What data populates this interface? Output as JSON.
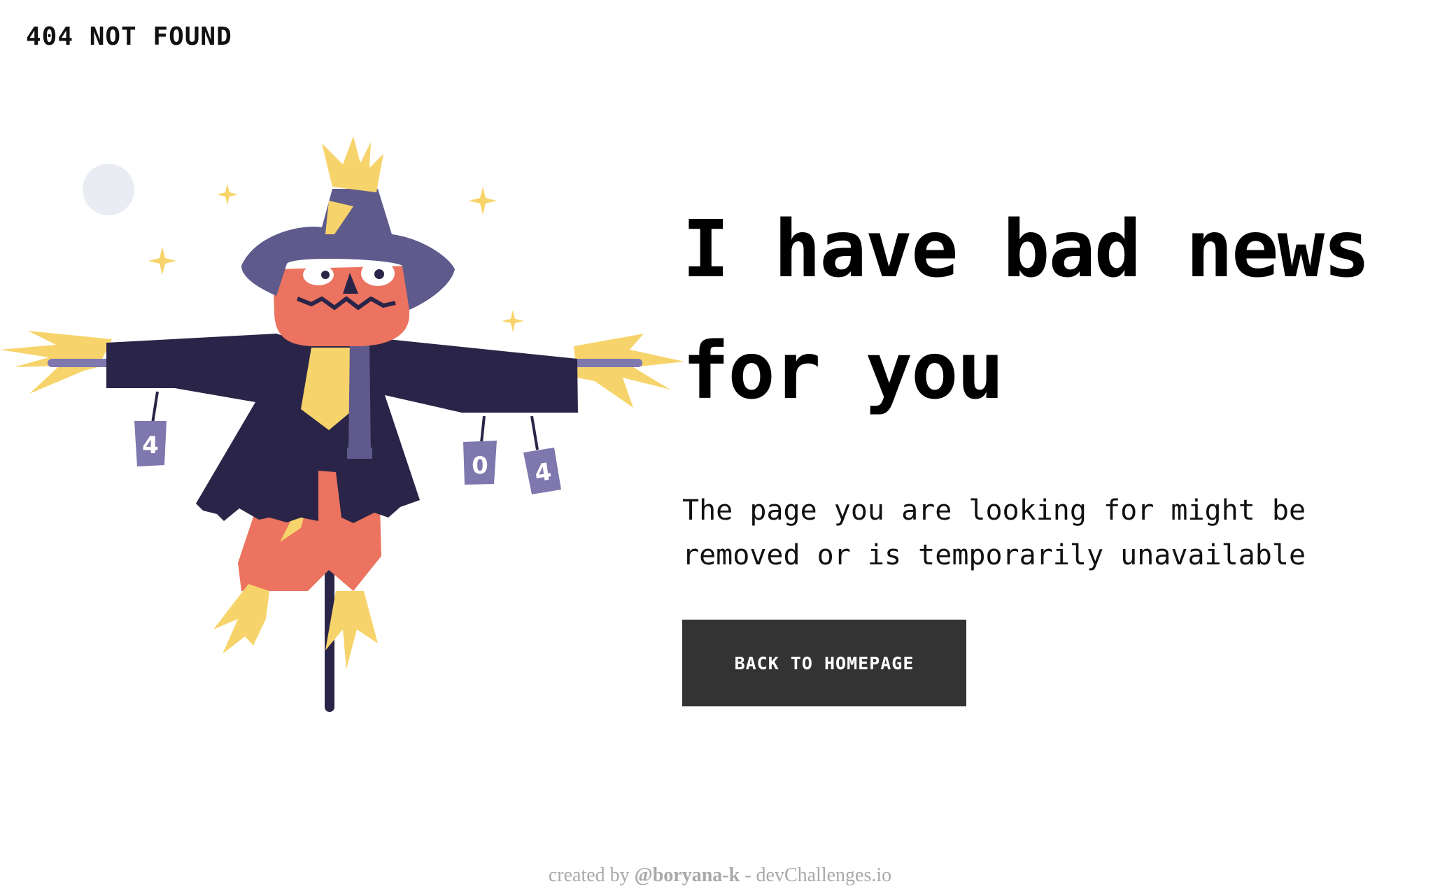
{
  "header": {
    "brand": "404 NOT FOUND"
  },
  "illustration": {
    "name": "scarecrow-illustration",
    "can_labels": [
      "4",
      "0",
      "4"
    ]
  },
  "main": {
    "headline_line1": "I have bad news",
    "headline_line2": "for you",
    "description_line1": "The page you are looking for might be",
    "description_line2": "removed or is temporarily unavailable",
    "button_label": "BACK TO HOMEPAGE"
  },
  "footer": {
    "prefix": "created by ",
    "author": "@boryana-k",
    "separator": " - ",
    "site": "devChallenges.io"
  },
  "colors": {
    "button_bg": "#333333",
    "hat": "#5F5A8C",
    "coat": "#2A2548",
    "face": "#EB735F",
    "straw": "#F7D46B",
    "can": "#7E78AE",
    "moon": "#E9EDF3"
  }
}
